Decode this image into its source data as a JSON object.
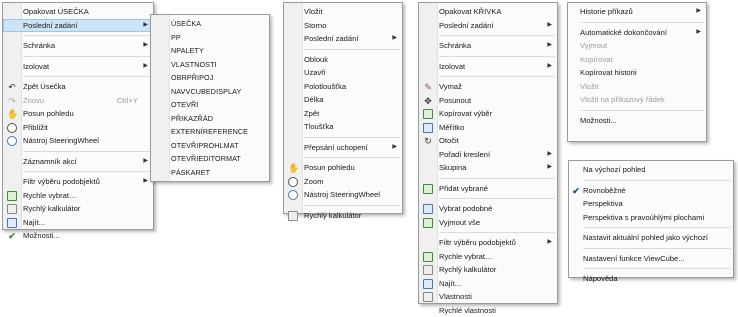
{
  "menu1": {
    "items": [
      {
        "label": "Opakovat ÚSEČKA"
      },
      {
        "label": "Poslední zadání"
      },
      {
        "label": "Schránka"
      },
      {
        "label": "Izolovat"
      },
      {
        "label": "Zpět Úsečka"
      },
      {
        "label": "Znovu",
        "shortcut": "Ctrl+Y"
      },
      {
        "label": "Posun pohledu"
      },
      {
        "label": "Přiblížit"
      },
      {
        "label": "Nástroj SteeringWheel"
      },
      {
        "label": "Záznamník akcí"
      },
      {
        "label": "Filtr výběru podobjektů"
      },
      {
        "label": "Rychle vybrat..."
      },
      {
        "label": "Rychlý kalkulátor"
      },
      {
        "label": "Najít..."
      },
      {
        "label": "Možnosti..."
      }
    ]
  },
  "submenu1": {
    "items": [
      "ÚSEČKA",
      "PP",
      "NPALETY",
      "VLASTNOSTI",
      "OBRPŘIPOJ",
      "NAVVCUBEDISPLAY",
      "OTEVŘI",
      "PŘIKAZŘÁD",
      "EXTERNÍREFERENCE",
      "OTEVŘIPROHLMAT",
      "OTEVŘIEDITORMAT",
      "PÁSKARET"
    ]
  },
  "menu2": {
    "items": [
      {
        "label": "Vložit"
      },
      {
        "label": "Storno"
      },
      {
        "label": "Poslední zadání"
      },
      {
        "label": "Oblouk"
      },
      {
        "label": "Uzavři"
      },
      {
        "label": "Polotloušťka"
      },
      {
        "label": "Délka"
      },
      {
        "label": "Zpět"
      },
      {
        "label": "Tloušťka"
      },
      {
        "label": "Přepsání uchopení"
      },
      {
        "label": "Posun pohledu"
      },
      {
        "label": "Zoom"
      },
      {
        "label": "Nástroj SteeringWheel"
      },
      {
        "label": "Rychlý kalkulátor"
      }
    ]
  },
  "menu3": {
    "items": [
      {
        "label": "Opakovat KŘIVKA"
      },
      {
        "label": "Poslední zadání"
      },
      {
        "label": "Schránka"
      },
      {
        "label": "Izolovat"
      },
      {
        "label": "Vymaž"
      },
      {
        "label": "Posunout"
      },
      {
        "label": "Kopírovat výběr"
      },
      {
        "label": "Měřítko"
      },
      {
        "label": "Otočit"
      },
      {
        "label": "Pořadí kreslení"
      },
      {
        "label": "Skupina"
      },
      {
        "label": "Přidat vybrané"
      },
      {
        "label": "Vybrat podobné"
      },
      {
        "label": "Vyjmout vše"
      },
      {
        "label": "Filtr výběru podobjektů"
      },
      {
        "label": "Rychle vybrat..."
      },
      {
        "label": "Rychlý kalkulátor"
      },
      {
        "label": "Najít..."
      },
      {
        "label": "Vlastnosti"
      },
      {
        "label": "Rychlé vlastnosti"
      }
    ]
  },
  "menu4": {
    "items": [
      {
        "label": "Historie příkazů"
      },
      {
        "label": "Automatické dokončování"
      },
      {
        "label": "Vyjmout"
      },
      {
        "label": "Kopírovat"
      },
      {
        "label": "Kopírovat historii"
      },
      {
        "label": "Vložit"
      },
      {
        "label": "Vložit na příkazový řádek"
      },
      {
        "label": "Možnosti..."
      }
    ]
  },
  "menu5": {
    "items": [
      {
        "label": "Na výchozí pohled"
      },
      {
        "label": "Rovnoběžné"
      },
      {
        "label": "Perspektiva"
      },
      {
        "label": "Perspektiva s pravoúhlými plochami"
      },
      {
        "label": "Nastavit aktuální pohled jako výchozí"
      },
      {
        "label": "Nastavení funkce ViewCube..."
      },
      {
        "label": "Nápověda"
      }
    ]
  },
  "icons": {
    "arrow": "chevron-right-icon",
    "check": "checkmark-icon"
  }
}
